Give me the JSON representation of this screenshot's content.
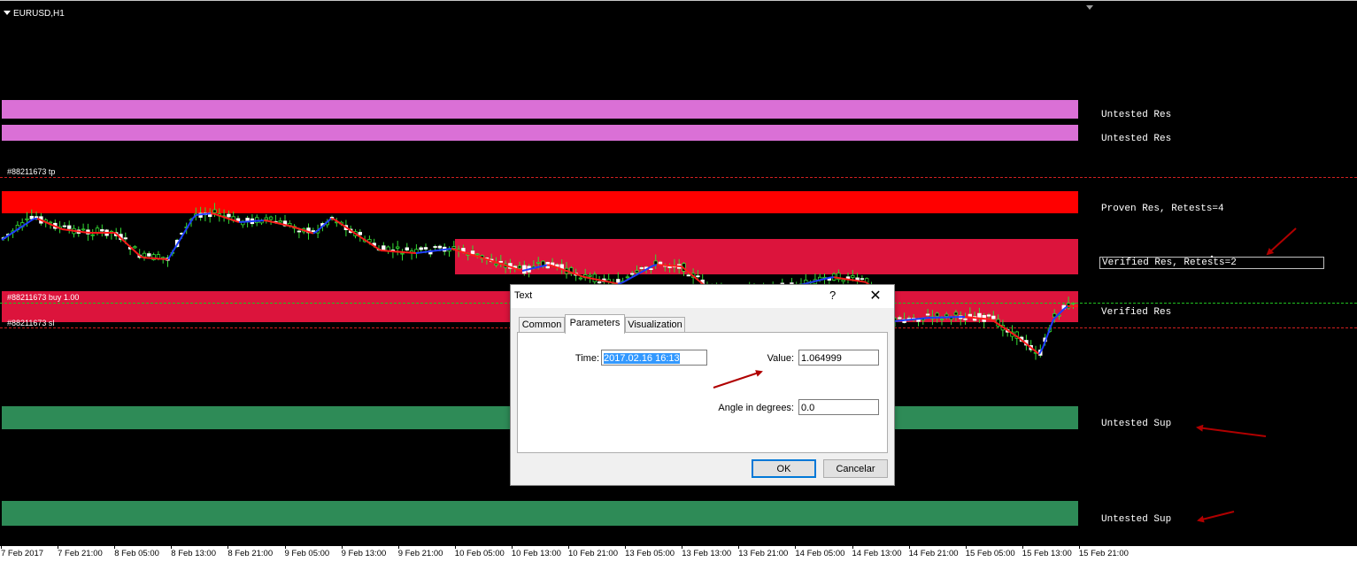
{
  "chart": {
    "symbol": "EURUSD,H1",
    "background": "#000000"
  },
  "zones": [
    {
      "label": "Untested Res",
      "color": "#da70d6"
    },
    {
      "label": "Untested Res",
      "color": "#da70d6"
    },
    {
      "label": "Proven Res, Retests=4",
      "color": "#ff0000"
    },
    {
      "label": "Verified Res, Retests=2",
      "color": "#dc143c"
    },
    {
      "label": "Verified Res",
      "color": "#dc143c"
    },
    {
      "label": "Untested Sup",
      "color": "#2e8b57"
    },
    {
      "label": "Untested Sup",
      "color": "#2e8b57"
    }
  ],
  "order_lines": {
    "tp": "#88211673 tp",
    "buy": "#88211673 buy 1.00",
    "sl": "#88211673 sl"
  },
  "time_axis": [
    "7 Feb 2017",
    "7 Feb 21:00",
    "8 Feb 05:00",
    "8 Feb 13:00",
    "8 Feb 21:00",
    "9 Feb 05:00",
    "9 Feb 13:00",
    "9 Feb 21:00",
    "10 Feb 05:00",
    "10 Feb 13:00",
    "10 Feb 21:00",
    "13 Feb 05:00",
    "13 Feb 13:00",
    "13 Feb 21:00",
    "14 Feb 05:00",
    "14 Feb 13:00",
    "14 Feb 21:00",
    "15 Feb 05:00",
    "15 Feb 13:00",
    "15 Feb 21:00"
  ],
  "dialog": {
    "title": "Text",
    "help": "?",
    "close": "✕",
    "tabs": [
      "Common",
      "Parameters",
      "Visualization"
    ],
    "active_tab": "Parameters",
    "fields": {
      "time_label": "Time:",
      "time_value": "2017.02.16 16:13",
      "value_label": "Value:",
      "value_value": "1.064999",
      "angle_label": "Angle in degrees:",
      "angle_value": "0.0"
    },
    "ok_label": "OK",
    "cancel_label": "Cancelar"
  }
}
